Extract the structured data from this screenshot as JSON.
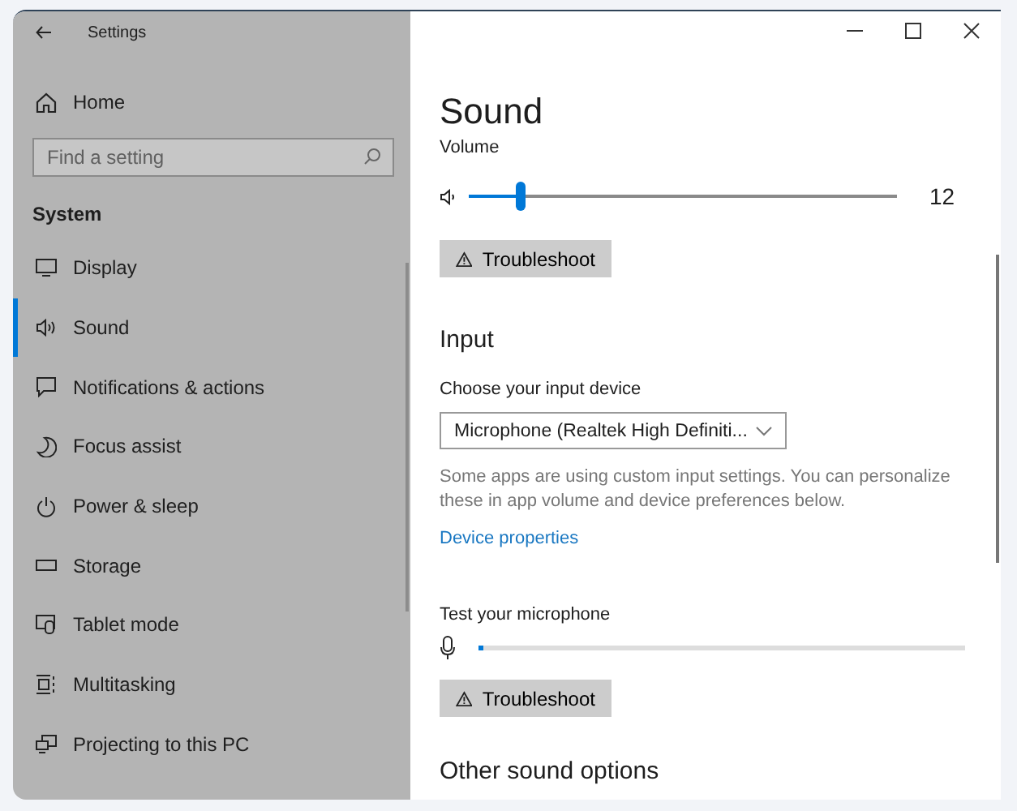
{
  "window": {
    "title": "Settings"
  },
  "sidebar": {
    "home": "Home",
    "search": {
      "placeholder": "Find a setting"
    },
    "section": "System",
    "items": [
      {
        "label": "Display",
        "selected": false
      },
      {
        "label": "Sound",
        "selected": true
      },
      {
        "label": "Notifications & actions",
        "selected": false
      },
      {
        "label": "Focus assist",
        "selected": false
      },
      {
        "label": "Power & sleep",
        "selected": false
      },
      {
        "label": "Storage",
        "selected": false
      },
      {
        "label": "Tablet mode",
        "selected": false
      },
      {
        "label": "Multitasking",
        "selected": false
      },
      {
        "label": "Projecting to this PC",
        "selected": false
      }
    ]
  },
  "content": {
    "title": "Sound",
    "volume": {
      "label": "Volume",
      "level": 0.12,
      "reading": "12"
    },
    "output_troubleshoot": "Troubleshoot",
    "input": {
      "heading": "Input",
      "device_label": "Choose your input device",
      "device": "Microphone (Realtek High Definiti...",
      "note": "Some apps are using custom input settings. You can personalize these in app volume and device preferences below.",
      "link": "Device properties",
      "test_label": "Test your microphone",
      "mic": {
        "level": 0.01
      },
      "troubleshoot": "Troubleshoot"
    },
    "next_heading": "Other sound options"
  }
}
